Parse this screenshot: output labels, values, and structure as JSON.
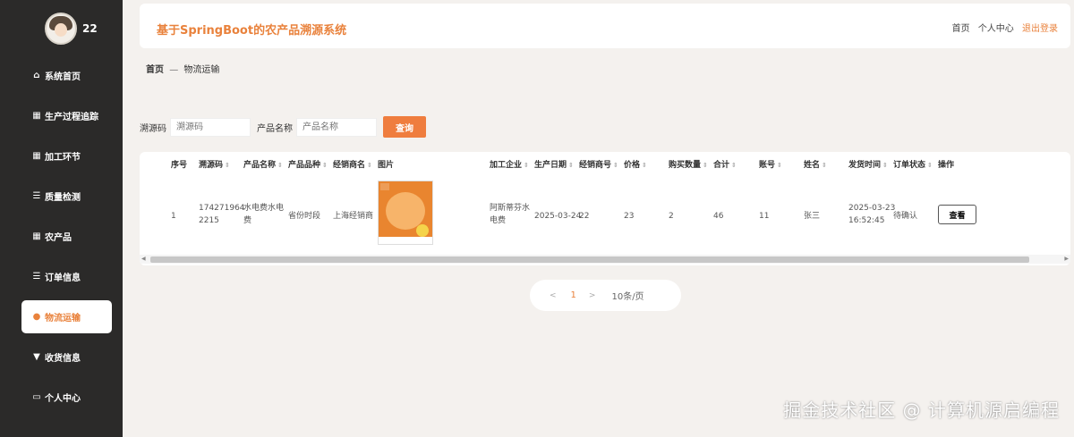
{
  "user": {
    "name": "22"
  },
  "sidebar": {
    "items": [
      {
        "label": "系统首页",
        "icon": "home-icon",
        "glyph": "⌂"
      },
      {
        "label": "生产过程追踪",
        "icon": "grid-icon",
        "glyph": "▦"
      },
      {
        "label": "加工环节",
        "icon": "grid-icon",
        "glyph": "▦"
      },
      {
        "label": "质量检测",
        "icon": "list-icon",
        "glyph": "☰"
      },
      {
        "label": "农产品",
        "icon": "grid-icon",
        "glyph": "▦"
      },
      {
        "label": "订单信息",
        "icon": "list-icon",
        "glyph": "☰"
      },
      {
        "label": "物流运输",
        "icon": "location-pin-icon",
        "glyph": "●"
      },
      {
        "label": "收货信息",
        "icon": "pin-icon",
        "glyph": "▼"
      },
      {
        "label": "个人中心",
        "icon": "window-icon",
        "glyph": "▭"
      }
    ],
    "active_index": 6
  },
  "header": {
    "title": "基于SpringBoot的农产品溯源系统",
    "links": {
      "home": "首页",
      "profile": "个人中心",
      "logout": "退出登录"
    }
  },
  "breadcrumb": {
    "home": "首页",
    "sep": "—",
    "current": "物流运输"
  },
  "search": {
    "trace_label": "溯源码",
    "trace_placeholder": "溯源码",
    "product_label": "产品名称",
    "product_placeholder": "产品名称",
    "button": "查询"
  },
  "table": {
    "headers": [
      "序号",
      "溯源码",
      "产品名称",
      "产品品种",
      "经销商名",
      "图片",
      "加工企业",
      "生产日期",
      "经销商号",
      "价格",
      "购买数量",
      "合计",
      "账号",
      "姓名",
      "发货时间",
      "订单状态",
      "操作"
    ],
    "sortable": [
      false,
      true,
      true,
      true,
      true,
      false,
      true,
      true,
      true,
      true,
      true,
      true,
      true,
      true,
      true,
      true,
      false
    ],
    "rows": [
      {
        "index": "1",
        "trace_code_1": "174271964",
        "trace_code_2": "2215",
        "product_name_1": "水电费水电",
        "product_name_2": "费",
        "variety": "省份时段",
        "dealer_name": "上海经销商",
        "processor_1": "阿斯蒂芬水",
        "processor_2": "电费",
        "production_date": "2025-03-24",
        "dealer_no": "22",
        "price": "23",
        "quantity": "2",
        "total": "46",
        "account": "11",
        "name": "张三",
        "ship_time_1": "2025-03-23",
        "ship_time_2": "16:52:45",
        "status": "待确认",
        "action": "查看"
      }
    ]
  },
  "pagination": {
    "prev": "<",
    "current": "1",
    "next": ">",
    "page_size": "10条/页"
  },
  "watermark": "掘金技术社区 @ 计算机源启编程",
  "colors": {
    "accent": "#e9823c",
    "sidebar": "#2b2a29",
    "button": "#ef7d3e"
  }
}
